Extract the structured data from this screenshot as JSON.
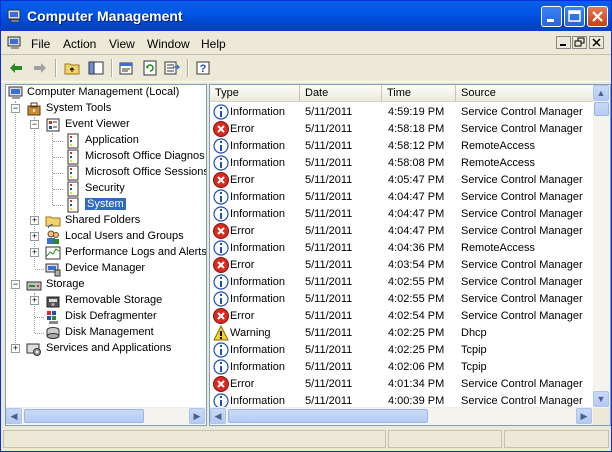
{
  "window": {
    "title": "Computer Management",
    "buttons": [
      "minimize",
      "maximize",
      "close"
    ]
  },
  "menu": [
    "File",
    "Action",
    "View",
    "Window",
    "Help"
  ],
  "toolbar": {
    "icons": [
      "back-icon",
      "forward-icon",
      "up-folder-icon",
      "show-hide-tree-icon",
      "properties-icon",
      "refresh-icon",
      "export-list-icon",
      "help-icon"
    ]
  },
  "tree": {
    "root": "Computer Management (Local)",
    "system_tools": "System Tools",
    "event_viewer": "Event Viewer",
    "ev_application": "Application",
    "ev_office_diag": "Microsoft Office Diagnos",
    "ev_office_sessions": "Microsoft Office Sessions",
    "ev_security": "Security",
    "ev_system": "System",
    "shared_folders": "Shared Folders",
    "local_users": "Local Users and Groups",
    "perf_logs": "Performance Logs and Alerts",
    "device_manager": "Device Manager",
    "storage": "Storage",
    "removable_storage": "Removable Storage",
    "disk_defrag": "Disk Defragmenter",
    "disk_mgmt": "Disk Management",
    "services_apps": "Services and Applications",
    "selected": "System"
  },
  "columns": [
    "Type",
    "Date",
    "Time",
    "Source"
  ],
  "events": [
    {
      "type": "Information",
      "date": "5/11/2011",
      "time": "4:59:19 PM",
      "source": "Service Control Manager"
    },
    {
      "type": "Error",
      "date": "5/11/2011",
      "time": "4:58:18 PM",
      "source": "Service Control Manager"
    },
    {
      "type": "Information",
      "date": "5/11/2011",
      "time": "4:58:12 PM",
      "source": "RemoteAccess"
    },
    {
      "type": "Information",
      "date": "5/11/2011",
      "time": "4:58:08 PM",
      "source": "RemoteAccess"
    },
    {
      "type": "Error",
      "date": "5/11/2011",
      "time": "4:05:47 PM",
      "source": "Service Control Manager"
    },
    {
      "type": "Information",
      "date": "5/11/2011",
      "time": "4:04:47 PM",
      "source": "Service Control Manager"
    },
    {
      "type": "Information",
      "date": "5/11/2011",
      "time": "4:04:47 PM",
      "source": "Service Control Manager"
    },
    {
      "type": "Error",
      "date": "5/11/2011",
      "time": "4:04:47 PM",
      "source": "Service Control Manager"
    },
    {
      "type": "Information",
      "date": "5/11/2011",
      "time": "4:04:36 PM",
      "source": "RemoteAccess"
    },
    {
      "type": "Error",
      "date": "5/11/2011",
      "time": "4:03:54 PM",
      "source": "Service Control Manager"
    },
    {
      "type": "Information",
      "date": "5/11/2011",
      "time": "4:02:55 PM",
      "source": "Service Control Manager"
    },
    {
      "type": "Information",
      "date": "5/11/2011",
      "time": "4:02:55 PM",
      "source": "Service Control Manager"
    },
    {
      "type": "Error",
      "date": "5/11/2011",
      "time": "4:02:54 PM",
      "source": "Service Control Manager"
    },
    {
      "type": "Warning",
      "date": "5/11/2011",
      "time": "4:02:25 PM",
      "source": "Dhcp"
    },
    {
      "type": "Information",
      "date": "5/11/2011",
      "time": "4:02:25 PM",
      "source": "Tcpip"
    },
    {
      "type": "Information",
      "date": "5/11/2011",
      "time": "4:02:06 PM",
      "source": "Tcpip"
    },
    {
      "type": "Error",
      "date": "5/11/2011",
      "time": "4:01:34 PM",
      "source": "Service Control Manager"
    },
    {
      "type": "Information",
      "date": "5/11/2011",
      "time": "4:00:39 PM",
      "source": "Service Control Manager"
    }
  ],
  "colors": {
    "title_bar": "#0055e5",
    "selection": "#316ac5",
    "error": "#d62b1e",
    "info": "#1d4fb5",
    "warning": "#f7d22c"
  }
}
